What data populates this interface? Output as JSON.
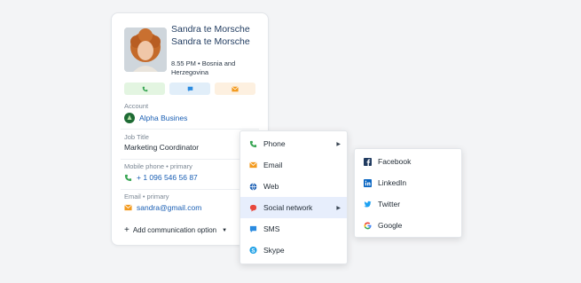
{
  "contact": {
    "name_line1": "Sandra te Morsche",
    "name_line2": "Sandra te Morsche",
    "meta": "8.55 PM • Bosnia and Herzegovina"
  },
  "account": {
    "label": "Account",
    "value": "Alpha Busines"
  },
  "job": {
    "label": "Job Title",
    "value": "Marketing Coordinator"
  },
  "mobile": {
    "label": "Mobile phone • primary",
    "value": "+ 1 096 546 56 87"
  },
  "email": {
    "label": "Email • primary",
    "value": "sandra@gmail.com"
  },
  "add_option": {
    "label": "Add communication option"
  },
  "menu": {
    "items": [
      {
        "label": "Phone",
        "icon": "phone-icon",
        "color": "#3aa655"
      },
      {
        "label": "Email",
        "icon": "email-icon",
        "color": "#f39a1e"
      },
      {
        "label": "Web",
        "icon": "globe-icon",
        "color": "#1a5fb4"
      },
      {
        "label": "Social network",
        "icon": "social-icon",
        "color": "#e8483d"
      },
      {
        "label": "SMS",
        "icon": "sms-icon",
        "color": "#2b8be0"
      },
      {
        "label": "Skype",
        "icon": "skype-icon",
        "color": "#1ea0e6"
      }
    ]
  },
  "submenu": {
    "items": [
      {
        "label": "Facebook",
        "icon": "facebook-icon",
        "color": "#1877f2"
      },
      {
        "label": "LinkedIn",
        "icon": "linkedin-icon",
        "color": "#0a66c2"
      },
      {
        "label": "Twitter",
        "icon": "twitter-icon",
        "color": "#1da1f2"
      },
      {
        "label": "Google",
        "icon": "google-icon",
        "color": "#ea4335"
      }
    ]
  }
}
